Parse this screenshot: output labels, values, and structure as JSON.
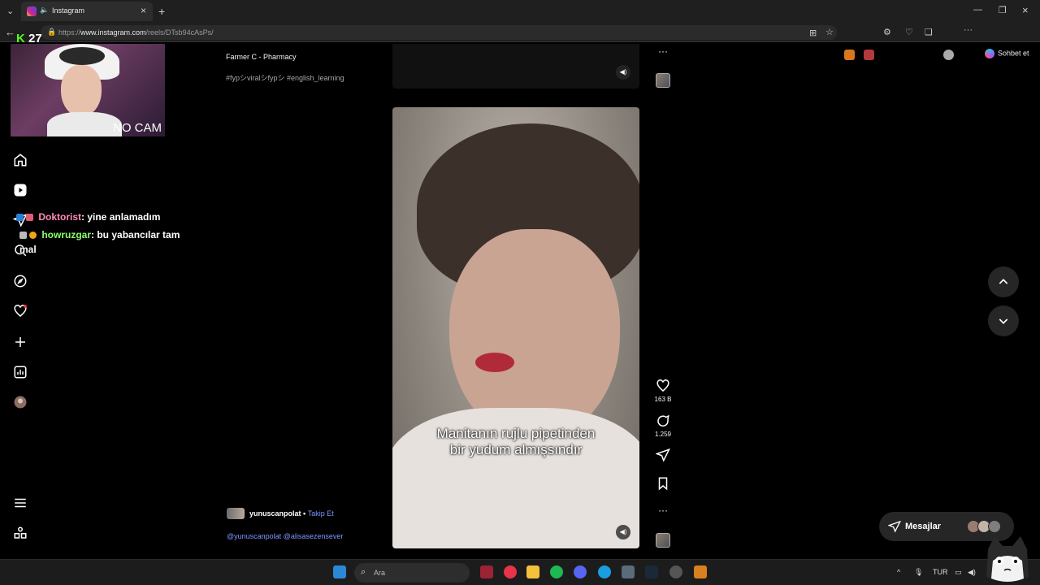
{
  "browser": {
    "tab_title": "Instagram",
    "url_prefix": "https://",
    "url_domain": "www.instagram.com",
    "url_path": "/reels/DTsb94cAsPs/",
    "copilot_label": "Sohbet et"
  },
  "stream": {
    "kick_count": "27",
    "cam_label": "NO CAM"
  },
  "chat": [
    {
      "user": "Doktorist",
      "message": ": yine anlamadım"
    },
    {
      "user": "howruzgar",
      "message": ": bu yabancılar tam"
    },
    {
      "continuation": "mal"
    }
  ],
  "feed": {
    "prev_post": {
      "audio": "Farmer C - Pharmacy",
      "hashtags": "#fypシviralシfypシ #english_learning"
    },
    "current_post": {
      "username": "yunuscanpolat",
      "separator": "•",
      "follow_label": "Takip Et",
      "mentions": "@yunuscanpolat @alisasezensever",
      "caption_line1": "Manitanın rujlu pipetinden",
      "caption_line2": "bir yudum almışsındır",
      "likes": "163 B",
      "comments": "1.259"
    }
  },
  "messages_label": "Mesajlar",
  "taskbar": {
    "search_placeholder": "Ara",
    "language": "TUR"
  },
  "colors": {
    "follow_blue": "#7b96ff",
    "chat_user1": "#ff8ab8",
    "chat_user2": "#8aff6a",
    "kick_green": "#53fc18"
  }
}
